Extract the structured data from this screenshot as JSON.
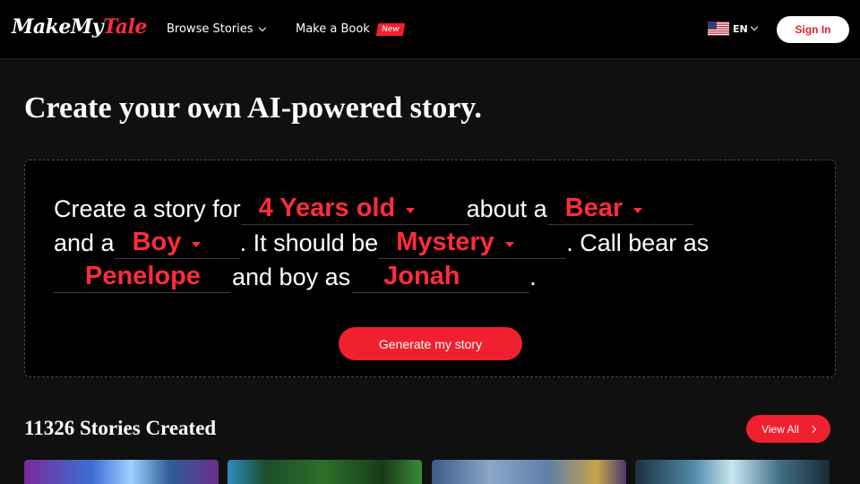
{
  "header": {
    "logo_part1": "MakeMy",
    "logo_part2": "Tale",
    "nav_browse": "Browse Stories",
    "nav_make": "Make a Book",
    "new_badge": "New",
    "language": "EN",
    "signin": "Sign In"
  },
  "hero": {
    "title": "Create your own AI-powered story."
  },
  "builder": {
    "t1": "Create a story for",
    "age": "4 Years old",
    "t2": "about a",
    "animal": "Bear",
    "t3": "and a",
    "child_type": "Boy",
    "t4": ". It should be",
    "genre": "Mystery",
    "t5": ". Call bear as",
    "animal_name": "Penelope",
    "t6": "and boy as",
    "child_name": "Jonah",
    "t7": ".",
    "generate": "Generate my story"
  },
  "stories": {
    "title": "11326 Stories Created",
    "view_all": "View All"
  },
  "colors": {
    "accent": "#f0202e",
    "background": "#101010"
  }
}
